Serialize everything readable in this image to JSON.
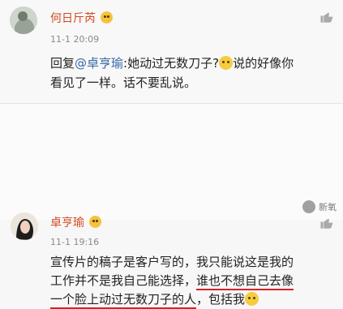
{
  "comments": [
    {
      "user": "何日斤芮",
      "timestamp": "11-1 20:09",
      "text_line1_prefix": "回复",
      "text_line1_mention": "@卓亨瑜",
      "text_line1_rest": ":她动过无数刀子?",
      "text_line1_after_emoji": "说的好像你",
      "text_line2": "看见了一样。话不要乱说。"
    },
    {
      "user": "卓亨瑜",
      "timestamp": "11-1 19:16",
      "text_line1": "宣传片的稿子是客户写的，我只能说这是我的",
      "text_line2_prefix": "工作并不是我自己能选择，",
      "text_line2_underlined": "谁也不想自己去像",
      "text_line3_underlined": "一个脸上动过无数刀子的人",
      "text_line3_rest": "，包括我"
    }
  ],
  "watermark": "新氧",
  "colors": {
    "username": "#d2481f",
    "mention": "#3566a6",
    "underline": "#d8212a"
  }
}
